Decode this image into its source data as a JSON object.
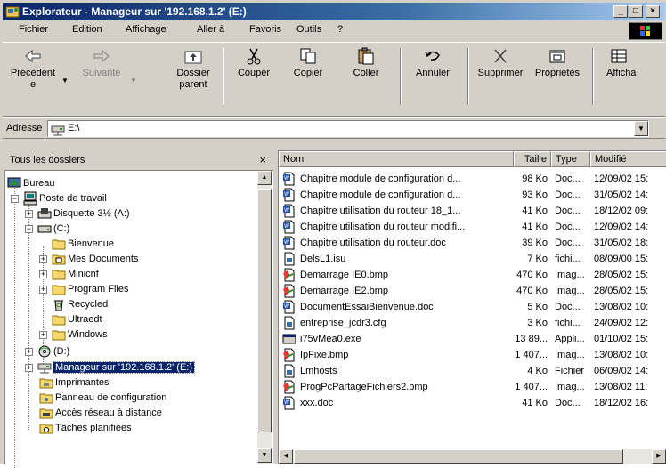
{
  "window": {
    "title": "Explorateur - Manageur sur '192.168.1.2' (E:)"
  },
  "menu": [
    {
      "label": "Fichier"
    },
    {
      "label": "Edition"
    },
    {
      "label": "Affichage"
    },
    {
      "label": "Aller à"
    },
    {
      "label": "Favoris"
    },
    {
      "label": "Outils"
    },
    {
      "label": "?"
    }
  ],
  "toolbar": {
    "back": {
      "line1": "Précédent",
      "line2": "e"
    },
    "forward": {
      "label": "Suivante"
    },
    "up": {
      "line1": "Dossier",
      "line2": "parent"
    },
    "cut": {
      "label": "Couper"
    },
    "copy": {
      "label": "Copier"
    },
    "paste": {
      "label": "Coller"
    },
    "undo": {
      "label": "Annuler"
    },
    "delete": {
      "label": "Supprimer"
    },
    "properties": {
      "label": "Propriétés"
    },
    "views": {
      "label": "Afficha"
    }
  },
  "address": {
    "label": "Adresse",
    "value": "E:\\"
  },
  "folders_pane": {
    "title": "Tous les dossiers",
    "close": "×",
    "items": [
      {
        "label": "Bureau"
      },
      {
        "label": "Poste de travail"
      },
      {
        "label": "Disquette 3½ (A:)"
      },
      {
        "label": "(C:)"
      },
      {
        "label": "Bienvenue"
      },
      {
        "label": "Mes Documents"
      },
      {
        "label": "Minicnf"
      },
      {
        "label": "Program Files"
      },
      {
        "label": "Recycled"
      },
      {
        "label": "Ultraedt"
      },
      {
        "label": "Windows"
      },
      {
        "label": "(D:)"
      },
      {
        "label": "Manageur sur '192.168.1.2' (E:)"
      },
      {
        "label": "Imprimantes"
      },
      {
        "label": "Panneau de configuration"
      },
      {
        "label": "Accès réseau à distance"
      },
      {
        "label": "Tâches planifiées"
      }
    ]
  },
  "files": {
    "columns": [
      "Nom",
      "Taille",
      "Type",
      "Modifié"
    ],
    "rows": [
      {
        "icon": "word-doc-icon",
        "name": "Chapitre module de configuration d...",
        "size": "98 Ko",
        "type": "Doc...",
        "modified": "12/09/02 15:"
      },
      {
        "icon": "word-doc-icon",
        "name": "Chapitre module de configuration d...",
        "size": "93 Ko",
        "type": "Doc...",
        "modified": "31/05/02 14:"
      },
      {
        "icon": "word-doc-icon",
        "name": "Chapitre utilisation du routeur 18_1...",
        "size": "41 Ko",
        "type": "Doc...",
        "modified": "18/12/02 09:"
      },
      {
        "icon": "word-doc-icon",
        "name": "Chapitre utilisation du routeur modifi...",
        "size": "41 Ko",
        "type": "Doc...",
        "modified": "12/09/02 14:"
      },
      {
        "icon": "word-doc-icon",
        "name": "Chapitre utilisation du routeur.doc",
        "size": "39 Ko",
        "type": "Doc...",
        "modified": "31/05/02 18:"
      },
      {
        "icon": "generic-file-icon",
        "name": "DelsL1.isu",
        "size": "7 Ko",
        "type": "fichi...",
        "modified": "08/09/00 15:"
      },
      {
        "icon": "bitmap-icon",
        "name": "Demarrage IE0.bmp",
        "size": "470 Ko",
        "type": "Imag...",
        "modified": "28/05/02 15:"
      },
      {
        "icon": "bitmap-icon",
        "name": "Demarrage IE2.bmp",
        "size": "470 Ko",
        "type": "Imag...",
        "modified": "28/05/02 15:"
      },
      {
        "icon": "word-doc-icon",
        "name": "DocumentEssaiBienvenue.doc",
        "size": "5 Ko",
        "type": "Doc...",
        "modified": "13/08/02 10:"
      },
      {
        "icon": "generic-file-icon",
        "name": "entreprise_jcdr3.cfg",
        "size": "3 Ko",
        "type": "fichi...",
        "modified": "24/09/02 12:"
      },
      {
        "icon": "exe-icon",
        "name": "i75vMea0.exe",
        "size": "13 89...",
        "type": "Appli...",
        "modified": "01/10/02 15:"
      },
      {
        "icon": "bitmap-icon",
        "name": "IpFixe.bmp",
        "size": "1 407...",
        "type": "Imag...",
        "modified": "13/08/02 10:"
      },
      {
        "icon": "generic-file-icon",
        "name": "Lmhosts",
        "size": "4 Ko",
        "type": "Fichier",
        "modified": "06/09/02 14:"
      },
      {
        "icon": "bitmap-icon",
        "name": "ProgPcPartageFichiers2.bmp",
        "size": "1 407...",
        "type": "Imag...",
        "modified": "13/08/02 11:"
      },
      {
        "icon": "word-doc-icon",
        "name": "xxx.doc",
        "size": "41 Ko",
        "type": "Doc...",
        "modified": "18/12/02 16:"
      }
    ]
  },
  "colors": {
    "titlebar_start": "#0a246a",
    "titlebar_end": "#a6caf0",
    "face": "#d4d0c8",
    "selection": "#0a246a"
  }
}
